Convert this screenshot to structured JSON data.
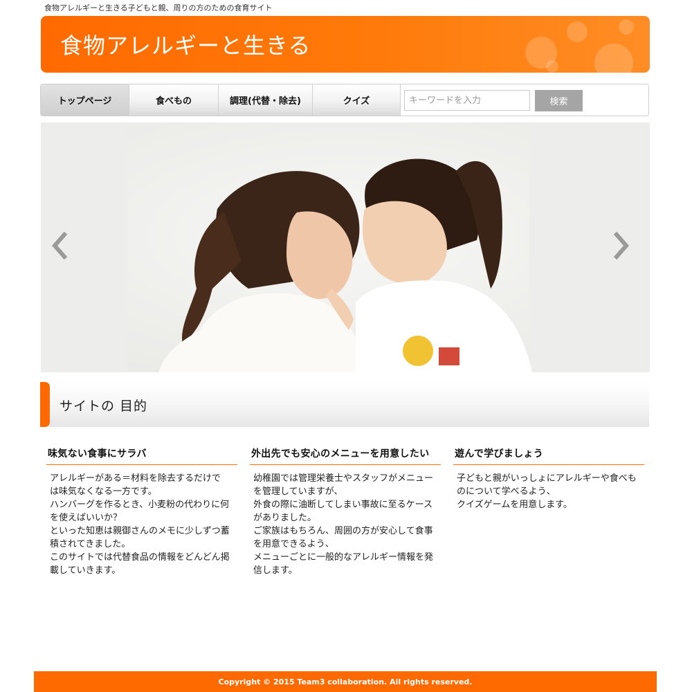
{
  "tagline": "食物アレルギーと生きる子どもと親、周りの方のための食育サイト",
  "banner": {
    "title": "食物アレルギーと生きる"
  },
  "nav": {
    "items": [
      {
        "label": "トップページ"
      },
      {
        "label": "食べもの"
      },
      {
        "label": "調理(代替・除去)"
      },
      {
        "label": "クイズ"
      }
    ],
    "search_placeholder": "キーワードを入力",
    "search_button": "検索"
  },
  "hero": {
    "prev_icon": "chevron-left-icon",
    "next_icon": "chevron-right-icon"
  },
  "section": {
    "title": "サイトの 目的"
  },
  "columns": [
    {
      "title": "味気ない食事にサラバ",
      "lines": [
        "アレルギーがある＝材料を除去するだけで",
        "は味気なくなる一方です。",
        "ハンバーグを作るとき、小麦粉の代わりに何",
        "を使えばいいか？",
        "といった知恵は親御さんのメモに少しずつ蓄",
        "積されてきました。",
        "このサイトでは代替食品の情報をどんどん掲",
        "載していきます。"
      ]
    },
    {
      "title": "外出先でも安心のメニューを用意したい",
      "lines": [
        "幼稚園では管理栄養士やスタッフがメニュー",
        "を管理していますが、",
        "外食の際に油断してしまい事故に至るケース",
        "がありました。",
        "ご家族はもちろん、周囲の方が安心して食事",
        "を用意できるよう、",
        "メニューごとに一般的なアレルギー情報を発",
        "信します。"
      ]
    },
    {
      "title": "遊んで学びましょう",
      "lines": [
        "子どもと親がいっしょにアレルギーや食べも",
        "のについて学べるよう、",
        "クイズゲームを用意します。"
      ]
    }
  ],
  "footer": {
    "copyright": "Copyright © 2015 Team3 collaboration. All rights reserved."
  },
  "colors": {
    "accent": "#ff6a00",
    "button_gray": "#a5a5a5"
  }
}
